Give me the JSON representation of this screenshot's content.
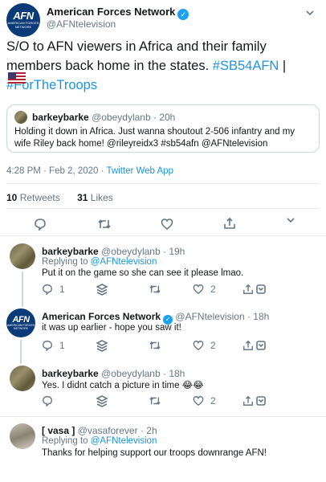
{
  "main_tweet": {
    "display_name": "American Forces Network",
    "handle": "@AFNtelevision",
    "text_plain": "S/O to AFN viewers in Africa and their family members back home in the states. ",
    "hashtag1": "#SB54AFN",
    "separator": " | ",
    "hashtag2": "#ForTheTroops",
    "timestamp": "4:28 PM · Feb 2, 2020 · ",
    "source": "Twitter Web App",
    "retweets_count": "10",
    "retweets_label": "Retweets",
    "likes_count": "31",
    "likes_label": "Likes"
  },
  "avatar": {
    "afn_big": "AFN",
    "afn_small": "AMERICAN FORCES NETWORK"
  },
  "quoted_tweet": {
    "display_name": "barkeybarke",
    "handle": "@obeydylanb",
    "age": "· 20h",
    "text": "Holding it down in Africa. Just wanna shoutout 2-506 infantry and my wife Riley back home! @rileyreidx3 #sb54afn @AFNtelevision"
  },
  "replies": [
    {
      "display_name": "barkeybarke",
      "handle": "@obeydylanb",
      "age": "· 19h",
      "replying_label": "Replying to ",
      "replying_to": "@AFNtelevision",
      "text": "Put it on the game so she can see it please lmao.",
      "reply_count": "1",
      "like_count": "2"
    },
    {
      "display_name": "American Forces Network",
      "handle": "@AFNtelevision",
      "age": "· 18h",
      "text": "it was up earlier - hope you saw it!",
      "reply_count": "1",
      "like_count": "2"
    },
    {
      "display_name": "barkeybarke",
      "handle": "@obeydylanb",
      "age": "· 18h",
      "text": "Yes. I didnt catch a picture in time 😂😂",
      "like_count": "2"
    },
    {
      "display_name": "[ vasa ]",
      "handle": "@vasaforever",
      "age": "· 2h",
      "replying_label": "Replying to ",
      "replying_to": "@AFNtelevision",
      "text": "Thanks for helping support our troops downrange AFN!"
    }
  ],
  "colors": {
    "link": "#1b95e0",
    "muted": "#657786",
    "verified": "#1da1f2"
  }
}
